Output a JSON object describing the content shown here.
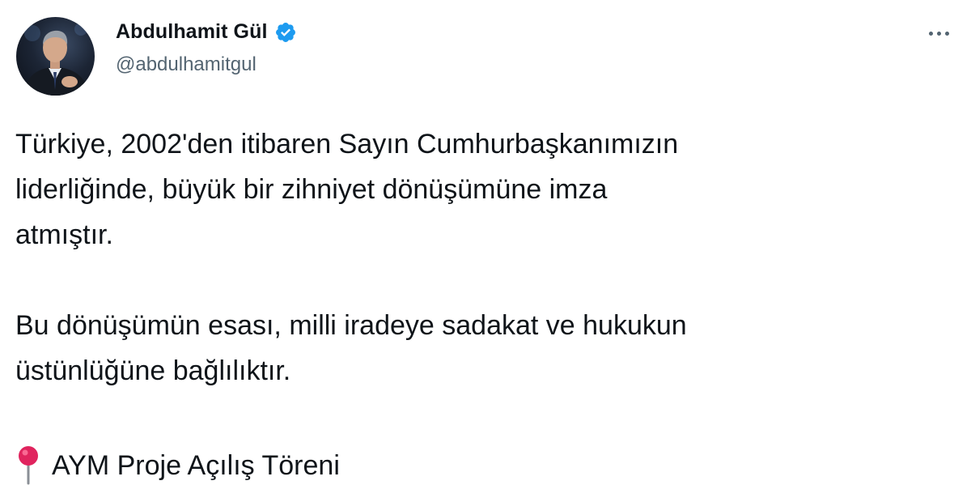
{
  "author": {
    "display_name": "Abdulhamit Gül",
    "handle": "@abdulhamitgul",
    "verified": true,
    "avatar_icon": "profile-photo"
  },
  "menu": {
    "icon": "more-horizontal-icon"
  },
  "tweet": {
    "paragraphs": [
      {
        "line1": "Türkiye, 2002'den itibaren Sayın Cumhurbaşkanımızın",
        "line2": "liderliğinde, büyük bir zihniyet dönüşümüne imza",
        "line3": "atmıştır."
      },
      {
        "line1": "Bu dönüşümün esası, milli iradeye sadakat ve hukukun",
        "line2": "üstünlüğüne bağlılıktır."
      }
    ],
    "location": {
      "icon": "round-pushpin-icon",
      "text": "AYM Proje Açılış Töreni"
    }
  },
  "colors": {
    "verified_badge": "#1d9bf0",
    "secondary_text": "#536471",
    "primary_text": "#0f1419",
    "pin": "#e0245e"
  }
}
